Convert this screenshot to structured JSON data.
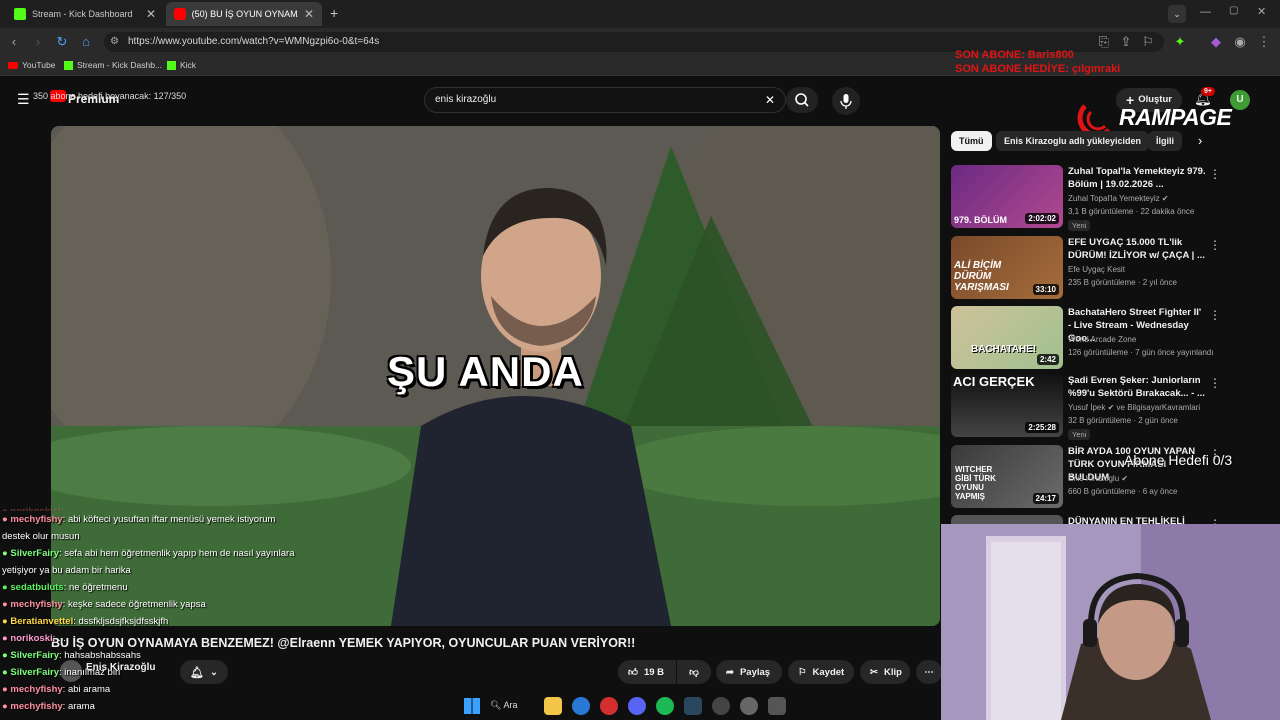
{
  "browser": {
    "tabs": [
      {
        "title": "Stream - Kick Dashboard",
        "active": false,
        "favicon_color": "#53fc18"
      },
      {
        "title": "(50) BU İŞ OYUN OYNAMAYA B...",
        "active": true,
        "favicon_color": "#ff0000"
      }
    ],
    "new_tab_label": "+",
    "url": "https://www.youtube.com/watch?v=WMNgzpi6o-0&t=64s",
    "bookmarks": [
      {
        "label": "YouTube",
        "color": "#ff0000"
      },
      {
        "label": "Stream - Kick Dashb...",
        "color": "#53fc18"
      },
      {
        "label": "Kick",
        "color": "#53fc18"
      }
    ]
  },
  "youtube": {
    "logo_text": "Premium",
    "search_value": "enis kirazoğlu",
    "create_label": "Oluştur",
    "notif_count": "9+",
    "avatar_letter": "U",
    "video": {
      "caption": "ŞU ANDA",
      "title": "BU İŞ OYUN OYNAMAYA BENZEMEZ! @Elraenn YEMEK YAPIYOR, OYUNCULAR PUAN VERİYOR!!",
      "channel": "Enis Kirazoğlu",
      "likes": "19 B",
      "share_label": "Paylaş",
      "save_label": "Kaydet",
      "clip_label": "Klip"
    },
    "chips": [
      "Tümü",
      "Enis Kirazoglu adlı yükleyiciden",
      "İlgili"
    ],
    "recommendations": [
      {
        "title": "Zuhal Topal'la Yemekteyiz 979. Bölüm | 19.02.2026 ...",
        "channel": "Zuhal Topal'la Yemekteyiz",
        "meta": "3,1 B görüntüleme · 22 dakika önce",
        "badge": "Yeni",
        "duration": "2:02:02",
        "thumb_text": "979. BÖLÜM",
        "thumb_color": "#6a2a82"
      },
      {
        "title": "EFE UYGAÇ 15.000 TL'lik DÜRÜM! İZLİYOR w/ ÇAÇA | ...",
        "channel": "Efe Uygaç Kesit",
        "meta": "235 B görüntüleme · 2 yıl önce",
        "badge": "",
        "duration": "33:10",
        "thumb_text": "ALİ BİÇİM DÜRÜM YARIŞMASI",
        "thumb_color": "#7a4a2a"
      },
      {
        "title": "BachataHero Street Fighter II' - Live  Stream - Wednesday Goo...",
        "channel": "World Arcade Zone",
        "meta": "126 görüntüleme · 7 gün önce yayınlandı",
        "badge": "",
        "duration": "2:42",
        "thumb_text": "BACHATAHE!",
        "thumb_color": "#cfc29a"
      },
      {
        "title": "Şadi Evren Şeker: Juniorların %99'u Sektörü Bırakacak... - ...",
        "channel": "Yusuf İpek",
        "channel2": "ve BilgisayarKavramlari",
        "meta": "32 B görüntüleme · 2 gün önce",
        "badge": "Yeni",
        "duration": "2:25:28",
        "thumb_text": "ACI GERÇEK",
        "thumb_color": "#2a2a2a"
      },
      {
        "title": "BİR AYDA 100 OYUN YAPAN TÜRK OYUN FİRMASI BULDUM",
        "channel": "Enis Kirazoglu",
        "meta": "660 B görüntüleme · 6 ay önce",
        "badge": "",
        "duration": "24:17",
        "thumb_text": "WITCHER GİBİ TÜRK OYUNU YAPMIŞ",
        "thumb_color": "#3a3a3a"
      },
      {
        "title": "DÜNYANIN EN TEHLİKELİ",
        "channel": "",
        "meta": "",
        "badge": "",
        "duration": "",
        "thumb_text": "",
        "thumb_color": "#555"
      }
    ]
  },
  "stream_overlay": {
    "abone_line1": "SON ABONE: Baris800",
    "abone_line2": "SON ABONE HEDİYE: çılgınraki",
    "brand": "RAMPAGE",
    "goal_text": "Abone Hedefi 0/3",
    "subgoal_text": "350 abone hedefi boyanacak: 127/350",
    "colors": {
      "red": "#e01414",
      "kick_green": "#53fc18",
      "yt_red": "#ff0000"
    }
  },
  "chat": [
    {
      "user": "norikoskisi",
      "msg": ": ...",
      "color": "#ff7373",
      "partial": true
    },
    {
      "user": "mechyfishy",
      "msg": ": abi köfteci yusuftan iftar menüsü yemek istiyorum destek olur musun",
      "color": "#ff8fa3"
    },
    {
      "user": "SilverFairy",
      "msg": ": sefa abi hem öğretmenlik yapıp hem de nasıl yayınlara yetişiyor ya bu adam bir harika",
      "color": "#7fff7f"
    },
    {
      "user": "sedatbuluts",
      "msg": ": ne öğretmenu",
      "color": "#5ef25e"
    },
    {
      "user": "mechyfishy",
      "msg": ": keşke sadece öğretmenlik yapsa",
      "color": "#ff8fa3"
    },
    {
      "user": "Beratianvettel",
      "msg": ": dssfkljsdsjfksjdfsskjfh",
      "color": "#ffd84a"
    },
    {
      "user": "norikoski",
      "msg": ": ...",
      "color": "#ff9bd1"
    },
    {
      "user": "SilverFairy",
      "msg": ": hahsabshabssahs",
      "color": "#7fff7f"
    },
    {
      "user": "SilverFairy",
      "msg": ": inanılmaz biri",
      "color": "#7fff7f"
    },
    {
      "user": "mechyfishy",
      "msg": ": abi arama",
      "color": "#ff8fa3"
    },
    {
      "user": "mechyfishy",
      "msg": ": arama",
      "color": "#ff8fa3"
    }
  ],
  "taskbar": {
    "search_label": "Ara",
    "icons": [
      "windows-icon",
      "search-icon",
      "file-explorer-icon",
      "chrome-icon",
      "vivaldi-icon",
      "discord-icon",
      "spotify-icon",
      "steam-icon",
      "obs-icon",
      "settings-icon",
      "app-icon"
    ]
  }
}
